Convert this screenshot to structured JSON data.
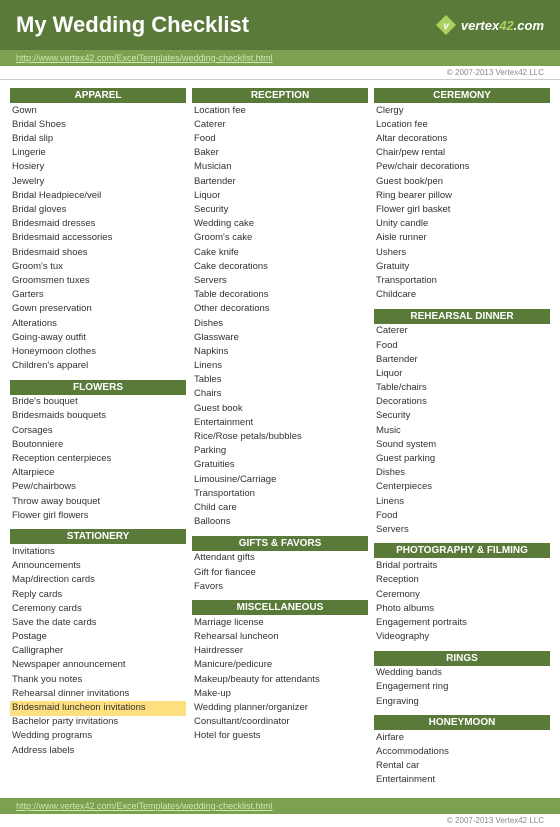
{
  "header": {
    "title": "My Wedding Checklist",
    "url_top": "http://www.vertex42.com/ExcelTemplates/wedding-checklist.html",
    "url_bottom": "http://www.vertex42.com/ExcelTemplates/wedding-checklist.html",
    "copyright_top": "© 2007-2013 Vertex42 LLC",
    "copyright_bottom": "© 2007-2013 Vertex42 LLC",
    "logo_text": "vertex42"
  },
  "columns": {
    "col1": {
      "sections": [
        {
          "header": "APPAREL",
          "items": [
            "Gown",
            "Bridal Shoes",
            "Bridal slip",
            "Lingerie",
            "Hosiery",
            "Jewelry",
            "Bridal Headpiece/veil",
            "Bridal gloves",
            "Bridesmaid dresses",
            "Bridesmaid accessories",
            "Bridesmaid shoes",
            "Groom's tux",
            "Groomsmen tuxes",
            "Garters",
            "Gown preservation",
            "Alterations",
            "Going-away outfit",
            "Honeymoon clothes",
            "Children's apparel"
          ]
        },
        {
          "header": "FLOWERS",
          "items": [
            "Bride's bouquet",
            "Bridesmaids bouquets",
            "Corsages",
            "Boutonniere",
            "Reception centerpieces",
            "Altarpiece",
            "Pew/chairbows",
            "Throw away bouquet",
            "Flower girl flowers"
          ]
        },
        {
          "header": "STATIONERY",
          "items": [
            "Invitations",
            "Announcements",
            "Map/direction cards",
            "Reply cards",
            "Ceremony cards",
            "Save the date cards",
            "Postage",
            "Calligrapher",
            "Newspaper announcement",
            "Thank you notes",
            "Rehearsal dinner invitations",
            "Bridesmaid luncheon invitations",
            "Bachelor party invitations",
            "Wedding programs",
            "Address labels"
          ]
        }
      ]
    },
    "col2": {
      "sections": [
        {
          "header": "RECEPTION",
          "items": [
            "Location fee",
            "Caterer",
            "Food",
            "Baker",
            "Musician",
            "Bartender",
            "Liquor",
            "Security",
            "Wedding cake",
            "Groom's cake",
            "Cake knife",
            "Cake decorations",
            "Servers",
            "Table decorations",
            "Other decorations",
            "Dishes",
            "Glassware",
            "Napkins",
            "Linens",
            "Tables",
            "Chairs",
            "Guest book",
            "Entertainment",
            "Rice/Rose petals/bubbles",
            "Parking",
            "Gratuities",
            "Limousine/Carriage",
            "Transportation",
            "Child care",
            "Balloons"
          ]
        },
        {
          "header": "GIFTS & FAVORS",
          "items": [
            "Attendant gifts",
            "Gift for fiancee",
            "Favors"
          ]
        },
        {
          "header": "MISCELLANEOUS",
          "items": [
            "Marriage license",
            "Rehearsal luncheon",
            "Hairdresser",
            "Manicure/pedicure",
            "Makeup/beauty for attendants",
            "Make-up",
            "Wedding planner/organizer",
            "Consultant/coordinator",
            "Hotel for guests"
          ]
        }
      ]
    },
    "col3": {
      "sections": [
        {
          "header": "CEREMONY",
          "items": [
            "Clergy",
            "Location fee",
            "Altar decorations",
            "Chair/pew rental",
            "Pew/chair decorations",
            "Guest book/pen",
            "Ring bearer pillow",
            "Flower girl basket",
            "Unity candle",
            "Aisle runner",
            "Ushers",
            "Gratuity",
            "Transportation",
            "Childcare"
          ]
        },
        {
          "header": "REHEARSAL DINNER",
          "items": [
            "Caterer",
            "Food",
            "Bartender",
            "Liquor",
            "Table/chairs",
            "Decorations",
            "Security",
            "Music",
            "Sound system",
            "Guest parking",
            "Dishes",
            "Centerpieces",
            "Linens",
            "Food",
            "Servers"
          ]
        },
        {
          "header": "PHOTOGRAPHY & FILMING",
          "items": [
            "Bridal portraits",
            "Reception",
            "Ceremony",
            "Photo albums",
            "Engagement portraits",
            "Videography"
          ]
        },
        {
          "header": "RINGS",
          "items": [
            "Wedding bands",
            "Engagement ring",
            "Engraving"
          ]
        },
        {
          "header": "HONEYMOON",
          "items": [
            "Airfare",
            "Accommodations",
            "Rental car",
            "Entertainment"
          ]
        }
      ]
    }
  }
}
